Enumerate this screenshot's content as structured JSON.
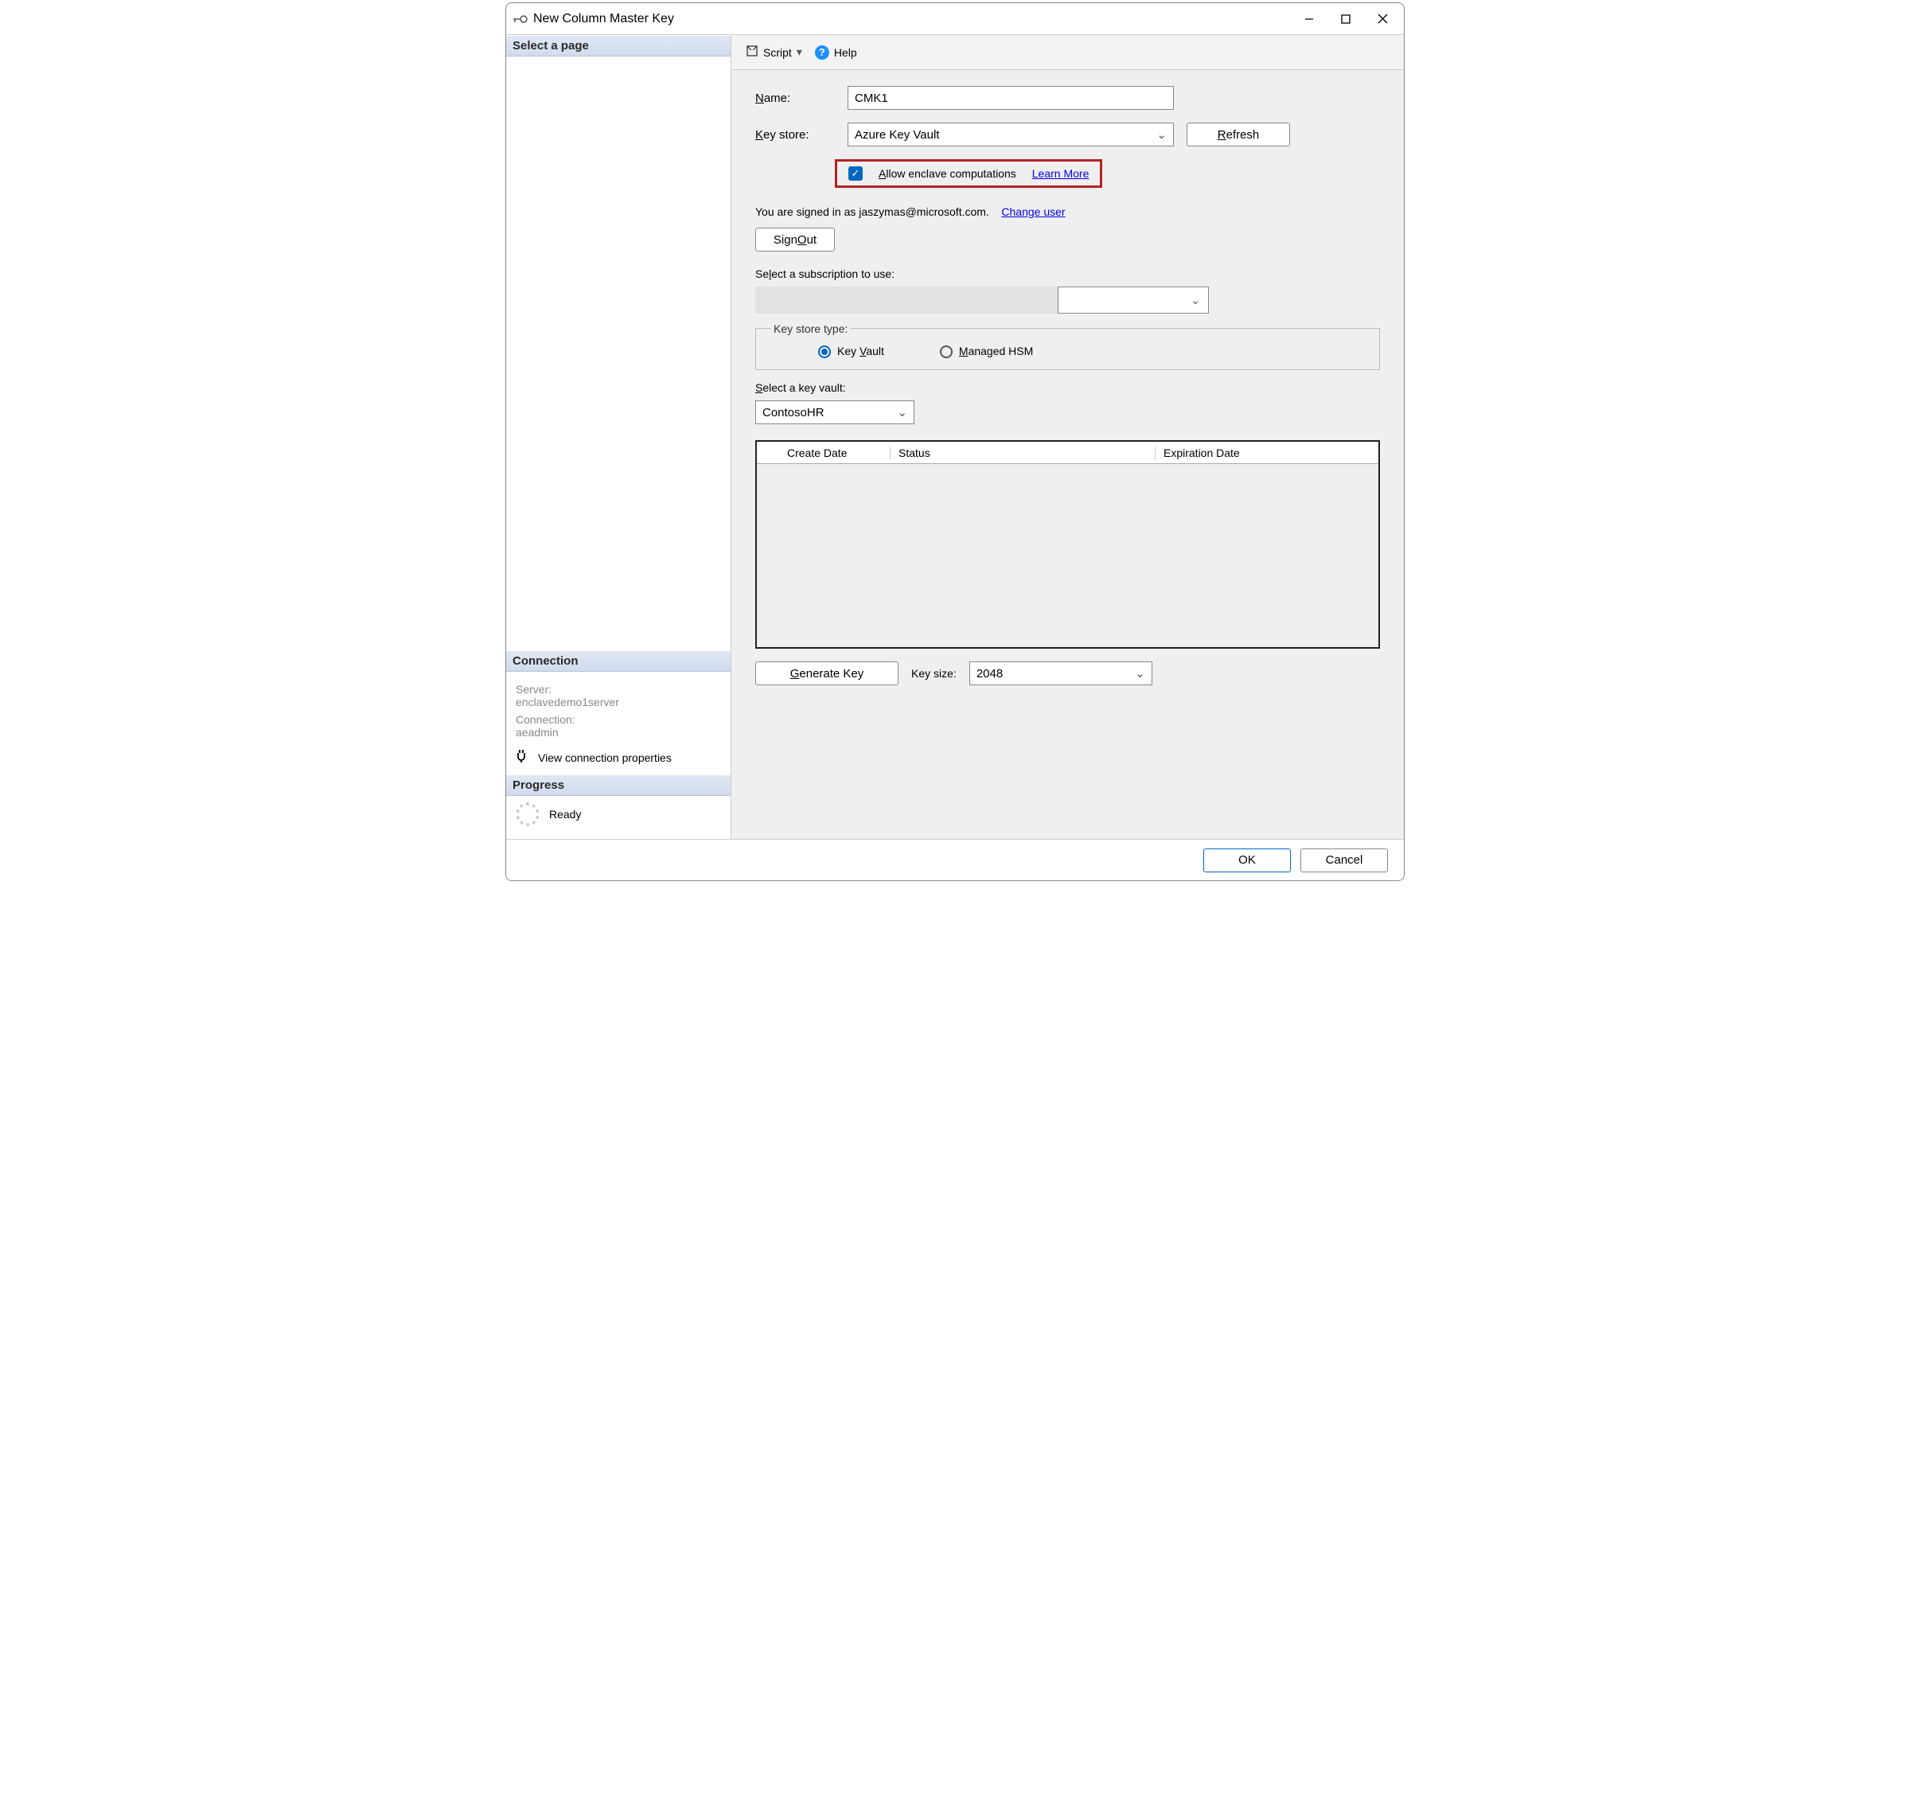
{
  "window": {
    "title": "New Column Master Key"
  },
  "sidebar": {
    "selectPage": "Select a page",
    "connectionHeader": "Connection",
    "serverLabel": "Server:",
    "serverValue": "enclavedemo1server",
    "connLabel": "Connection:",
    "connValue": "aeadmin",
    "viewProps": "View connection properties",
    "progressHeader": "Progress",
    "progressState": "Ready"
  },
  "toolbar": {
    "script": "Script",
    "help": "Help"
  },
  "form": {
    "nameLabel": "Name:",
    "nameValue": "CMK1",
    "keyStoreLabel": "Key store:",
    "keyStoreValue": "Azure Key Vault",
    "refresh": "Refresh",
    "allowEnclave": "Allow enclave computations",
    "learnMore": "Learn More",
    "signedInText": "You are signed in as jaszymas@microsoft.com.",
    "changeUser": "Change user",
    "signOut": "Sign Out",
    "selectSub": "Select a subscription to use:",
    "keyStoreTypeLegend": "Key store type:",
    "radioKeyVault": "Key Vault",
    "radioManagedHsm": "Managed HSM",
    "selectKeyVault": "Select a key vault:",
    "keyVaultValue": "ContosoHR",
    "tableHeaders": {
      "c1": "Create Date",
      "c2": "Status",
      "c3": "Expiration Date"
    },
    "generateKey": "Generate Key",
    "keySizeLabel": "Key size:",
    "keySizeValue": "2048"
  },
  "footer": {
    "ok": "OK",
    "cancel": "Cancel"
  }
}
